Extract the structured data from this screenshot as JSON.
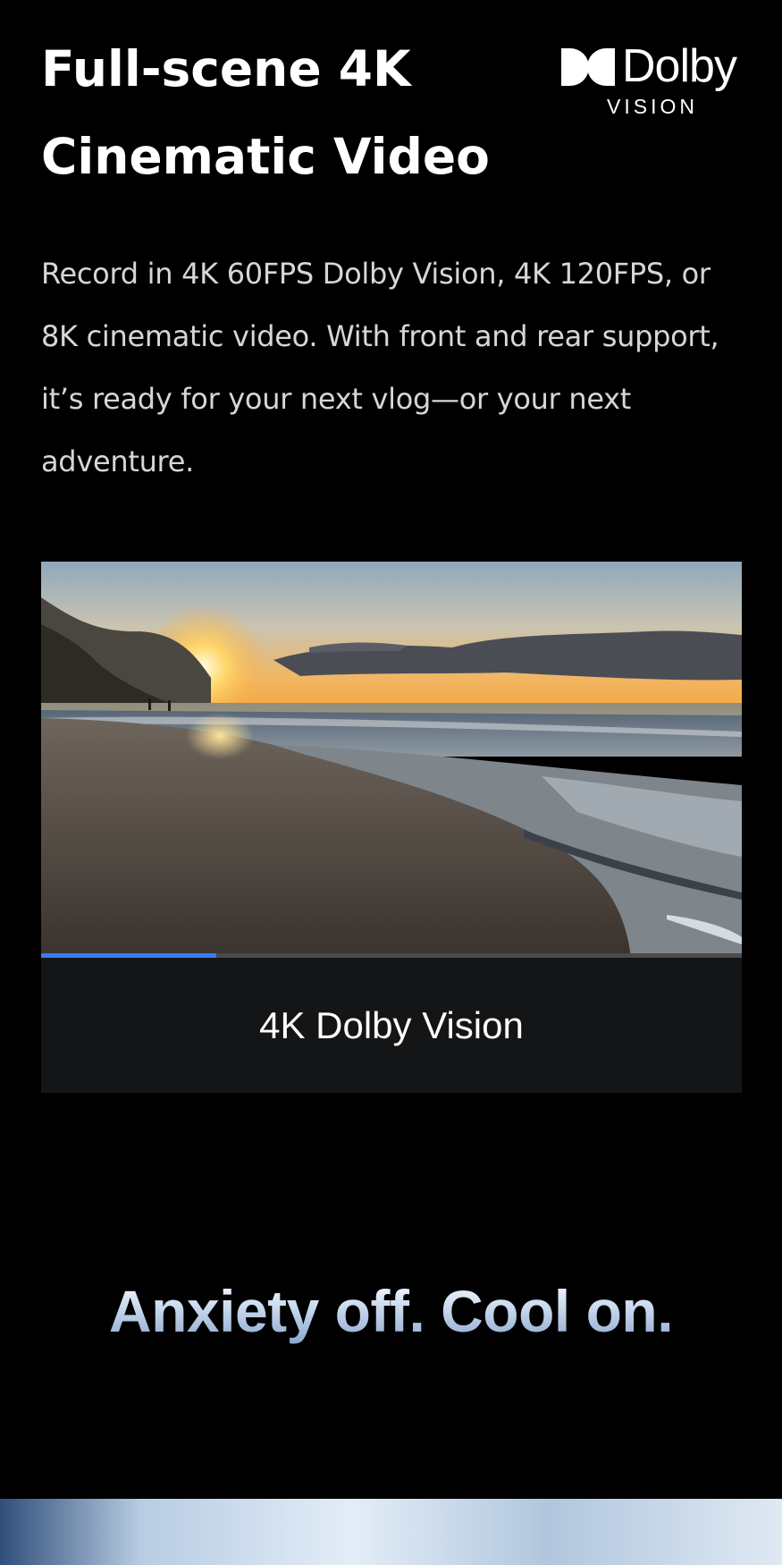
{
  "section": {
    "title_line1": "Full-scene 4K",
    "title_line2": "Cinematic Video",
    "description": "Record in 4K 60FPS Dolby Vision, 4K 120FPS, or 8K cinematic video. With front and rear support, it’s ready for your next vlog—or your next adventure."
  },
  "brand": {
    "logo_word": "Dolby",
    "logo_sub": "VISION",
    "icon": "dolby-double-d-icon"
  },
  "video": {
    "caption": "4K Dolby Vision",
    "progress": 0.25,
    "progress_color": "#3b7bff",
    "scene": "beach-sunset-image"
  },
  "tagline": {
    "text": "Anxiety off. Cool on."
  },
  "colors": {
    "background": "#000000",
    "caption_bar": "#141516",
    "tagline_gradient_start": "#ffffff",
    "tagline_gradient_end": "#8aa5cc"
  }
}
